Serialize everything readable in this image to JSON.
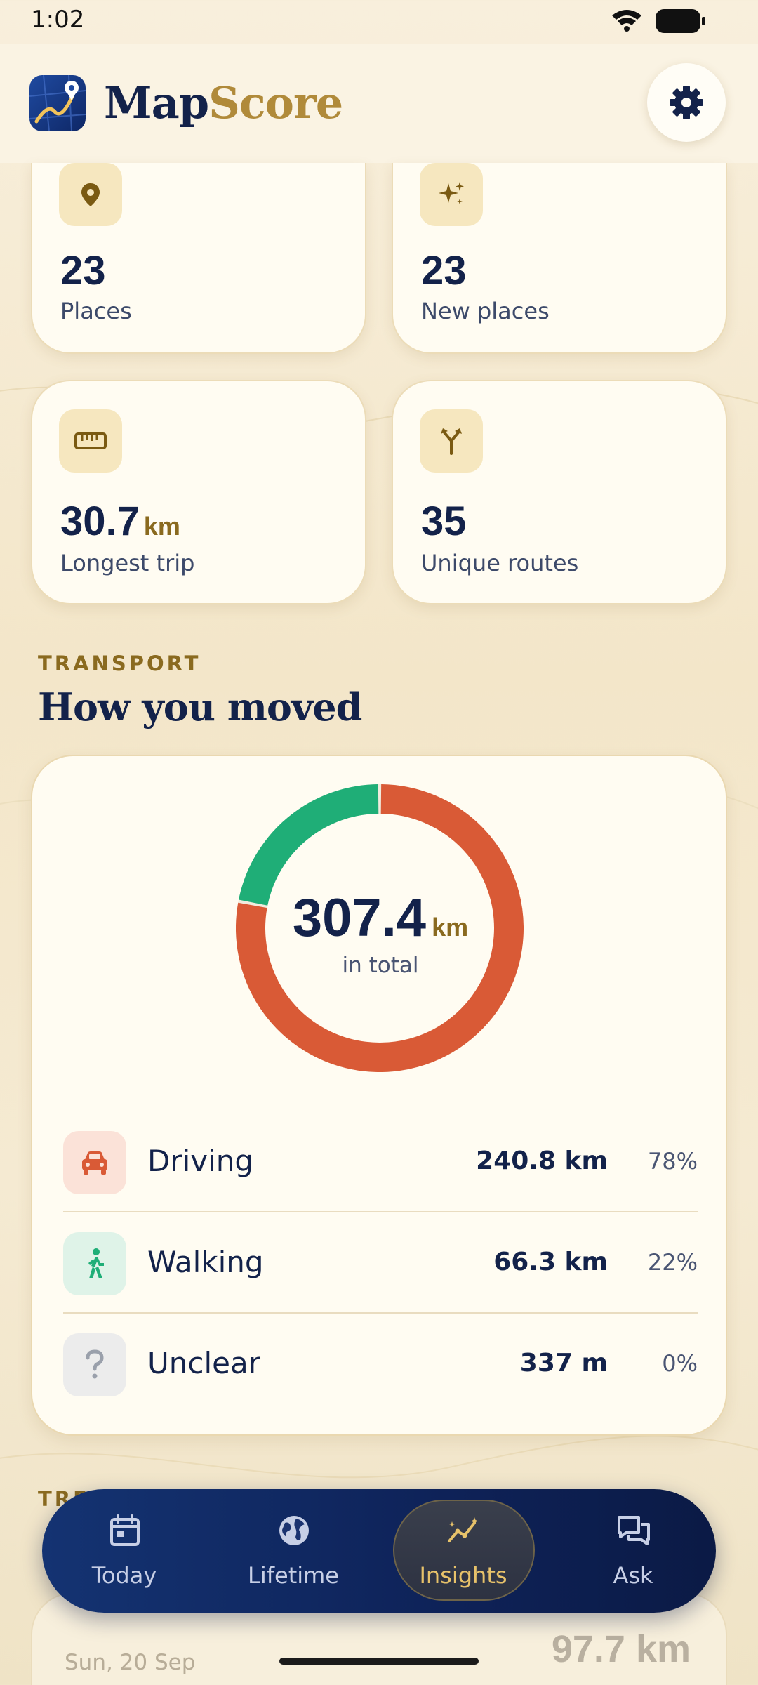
{
  "status_bar": {
    "time": "1:02"
  },
  "header": {
    "title_part1": "Map",
    "title_part2": "Score"
  },
  "stats": [
    {
      "value": "23",
      "unit": "",
      "label": "Places",
      "icon": "location-pin-icon"
    },
    {
      "value": "23",
      "unit": "",
      "label": "New places",
      "icon": "sparkles-icon"
    },
    {
      "value": "30.7",
      "unit": "km",
      "label": "Longest trip",
      "icon": "ruler-icon"
    },
    {
      "value": "35",
      "unit": "",
      "label": "Unique routes",
      "icon": "route-split-icon"
    }
  ],
  "transport": {
    "eyebrow": "TRANSPORT",
    "title": "How you moved",
    "total_value": "307.4",
    "total_unit": "km",
    "total_caption": "in total",
    "modes": [
      {
        "label": "Driving",
        "distance": "240.8 km",
        "percent": "78%",
        "share": 0.78,
        "color": "#d95a36",
        "bg": "#fbe2d8",
        "icon": "car-icon"
      },
      {
        "label": "Walking",
        "distance": "66.3 km",
        "percent": "22%",
        "share": 0.22,
        "color": "#1fae77",
        "bg": "#dff3e8",
        "icon": "walking-person-icon"
      },
      {
        "label": "Unclear",
        "distance": "337 m",
        "percent": "0%",
        "share": 0.0,
        "color": "#9aa0ab",
        "bg": "#ececec",
        "icon": "question-mark-icon"
      }
    ]
  },
  "trends": {
    "eyebrow": "TRE",
    "date": "Sun, 20 Sep",
    "value": "97.7 km"
  },
  "nav": [
    {
      "label": "Today",
      "icon": "calendar-icon"
    },
    {
      "label": "Lifetime",
      "icon": "globe-icon"
    },
    {
      "label": "Insights",
      "icon": "trend-chart-icon",
      "active": true
    },
    {
      "label": "Ask",
      "icon": "chat-bubbles-icon"
    }
  ],
  "colors": {
    "navy": "#13224a",
    "gold": "#b08a3a",
    "driving": "#d95a36",
    "walking": "#1fae77"
  }
}
